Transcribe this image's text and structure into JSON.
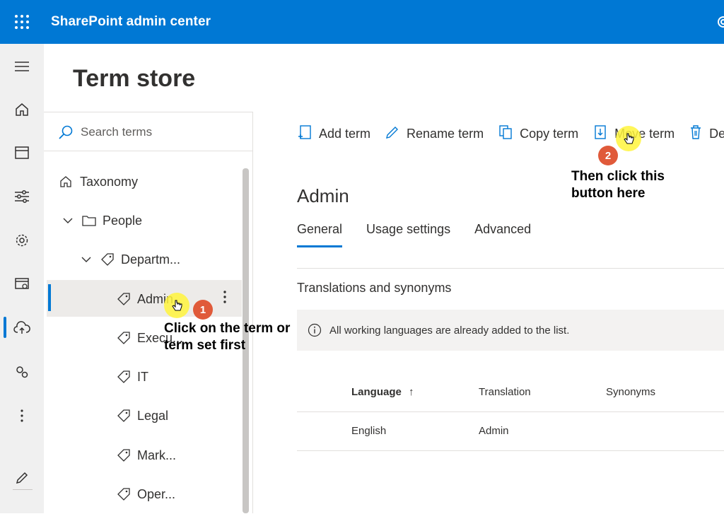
{
  "app": {
    "title": "SharePoint admin center"
  },
  "page": {
    "title": "Term store"
  },
  "search": {
    "placeholder": "Search terms"
  },
  "tree": {
    "items": [
      {
        "label": "Taxonomy"
      },
      {
        "label": "People"
      },
      {
        "label": "Departm..."
      },
      {
        "label": "Admin"
      },
      {
        "label": "Execu..."
      },
      {
        "label": "IT"
      },
      {
        "label": "Legal"
      },
      {
        "label": "Mark..."
      },
      {
        "label": "Oper..."
      }
    ]
  },
  "toolbar": {
    "add_term": "Add term",
    "rename_term": "Rename term",
    "copy_term": "Copy term",
    "move_term": "Move term",
    "delete_term": "De"
  },
  "detail": {
    "title": "Admin",
    "tabs": [
      {
        "label": "General"
      },
      {
        "label": "Usage settings"
      },
      {
        "label": "Advanced"
      }
    ],
    "section_title": "Translations and synonyms",
    "info_message": "All working languages are already added to the list.",
    "table": {
      "columns": [
        "Language",
        "Translation",
        "Synonyms"
      ],
      "sort_indicator": "↑",
      "rows": [
        {
          "language": "English",
          "translation": "Admin",
          "synonyms": ""
        }
      ]
    }
  },
  "annotations": {
    "step1_number": "1",
    "step1_text_line1": "Click on the term or",
    "step1_text_line2": "term set first",
    "step2_number": "2",
    "step2_text_line1": "Then click this",
    "step2_text_line2": "button here"
  },
  "colors": {
    "accent": "#0078d4",
    "badge": "#e05a3a",
    "highlight": "#fff53c"
  },
  "icons": [
    "app-launcher-icon",
    "settings-icon",
    "hamburger-icon",
    "home-icon",
    "sites-icon",
    "policies-icon",
    "gear-icon",
    "content-services-icon",
    "migration-icon",
    "advanced-icon",
    "more-icon",
    "edit-icon",
    "search-icon",
    "home-icon",
    "chevron-down-icon",
    "folder-icon",
    "tag-icon",
    "add-icon",
    "rename-icon",
    "copy-icon",
    "move-icon",
    "delete-icon",
    "info-icon"
  ]
}
